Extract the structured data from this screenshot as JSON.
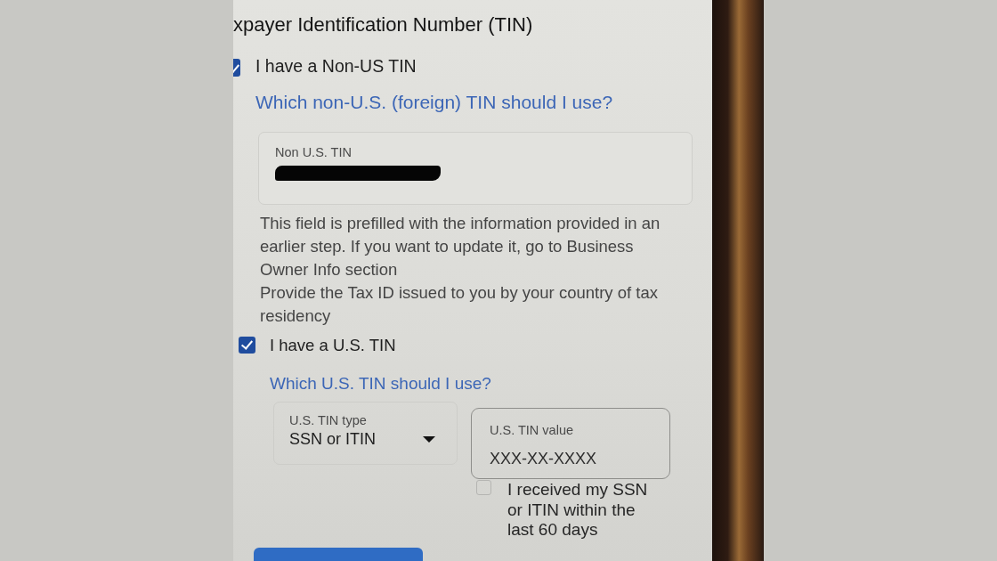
{
  "heading": "xpayer Identification Number (TIN)",
  "non_us_tin": {
    "label": "I have a Non-US TIN",
    "checked": true,
    "help_link": "Which non-U.S. (foreign) TIN should I use?",
    "field": {
      "label": "Non U.S. TIN",
      "redacted": true
    },
    "helper_texts": [
      "This field is prefilled with the information provided in an earlier step. If you want to update it, go to Business Owner Info section",
      "Provide the Tax ID issued to you by your country of tax residency"
    ]
  },
  "us_tin": {
    "label": "I have a U.S. TIN",
    "checked": true,
    "help_link": "Which U.S. TIN should I use?",
    "tin_type": {
      "label": "U.S. TIN type",
      "value": "SSN or ITIN"
    },
    "tin_value": {
      "label": "U.S. TIN value",
      "placeholder": "XXX-XX-XXXX"
    },
    "recent": {
      "label": "I received my SSN or ITIN within the last 60 days",
      "checked": false
    }
  }
}
